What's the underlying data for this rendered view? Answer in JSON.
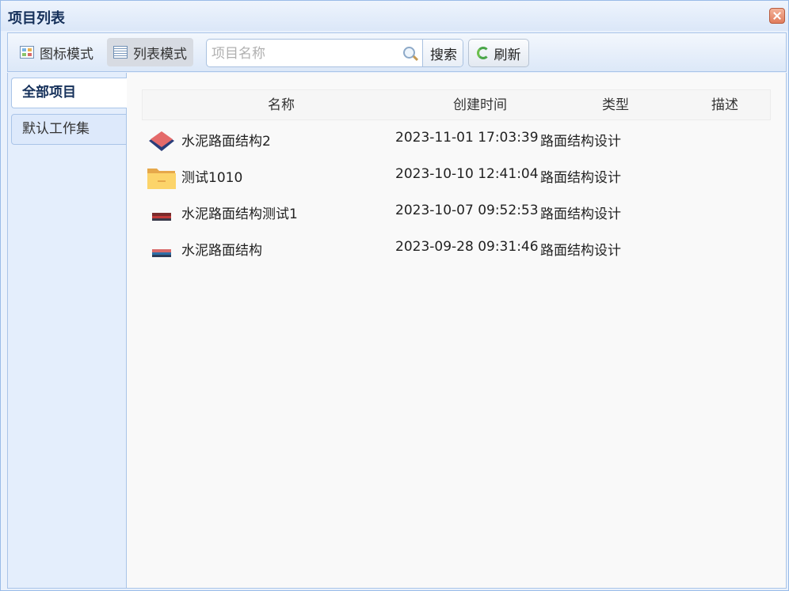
{
  "window": {
    "title": "项目列表"
  },
  "toolbar": {
    "icon_mode_label": "图标模式",
    "list_mode_label": "列表模式",
    "search_placeholder": "项目名称",
    "search_value": "",
    "search_label": "搜索",
    "refresh_label": "刷新"
  },
  "sidebar": {
    "items": [
      {
        "label": "全部项目",
        "active": true
      },
      {
        "label": "默认工作集",
        "active": false
      }
    ]
  },
  "table": {
    "headers": {
      "name": "名称",
      "created": "创建时间",
      "type": "类型",
      "desc": "描述"
    },
    "rows": [
      {
        "icon": "red-box-icon",
        "name": "水泥路面结构2",
        "created": "2023-11-01 17:03:39",
        "type": "路面结构设计",
        "desc": ""
      },
      {
        "icon": "folder-icon",
        "name": "测试1010",
        "created": "2023-10-10 12:41:04",
        "type": "路面结构设计",
        "desc": ""
      },
      {
        "icon": "road-layer-icon",
        "name": "水泥路面结构测试1",
        "created": "2023-10-07 09:52:53",
        "type": "路面结构设计",
        "desc": ""
      },
      {
        "icon": "road-layer-blue-icon",
        "name": "水泥路面结构",
        "created": "2023-09-28 09:31:46",
        "type": "路面结构设计",
        "desc": ""
      }
    ]
  },
  "colors": {
    "title": "#15305a",
    "border": "#a9c4e8",
    "accent": "#e07c5c"
  }
}
